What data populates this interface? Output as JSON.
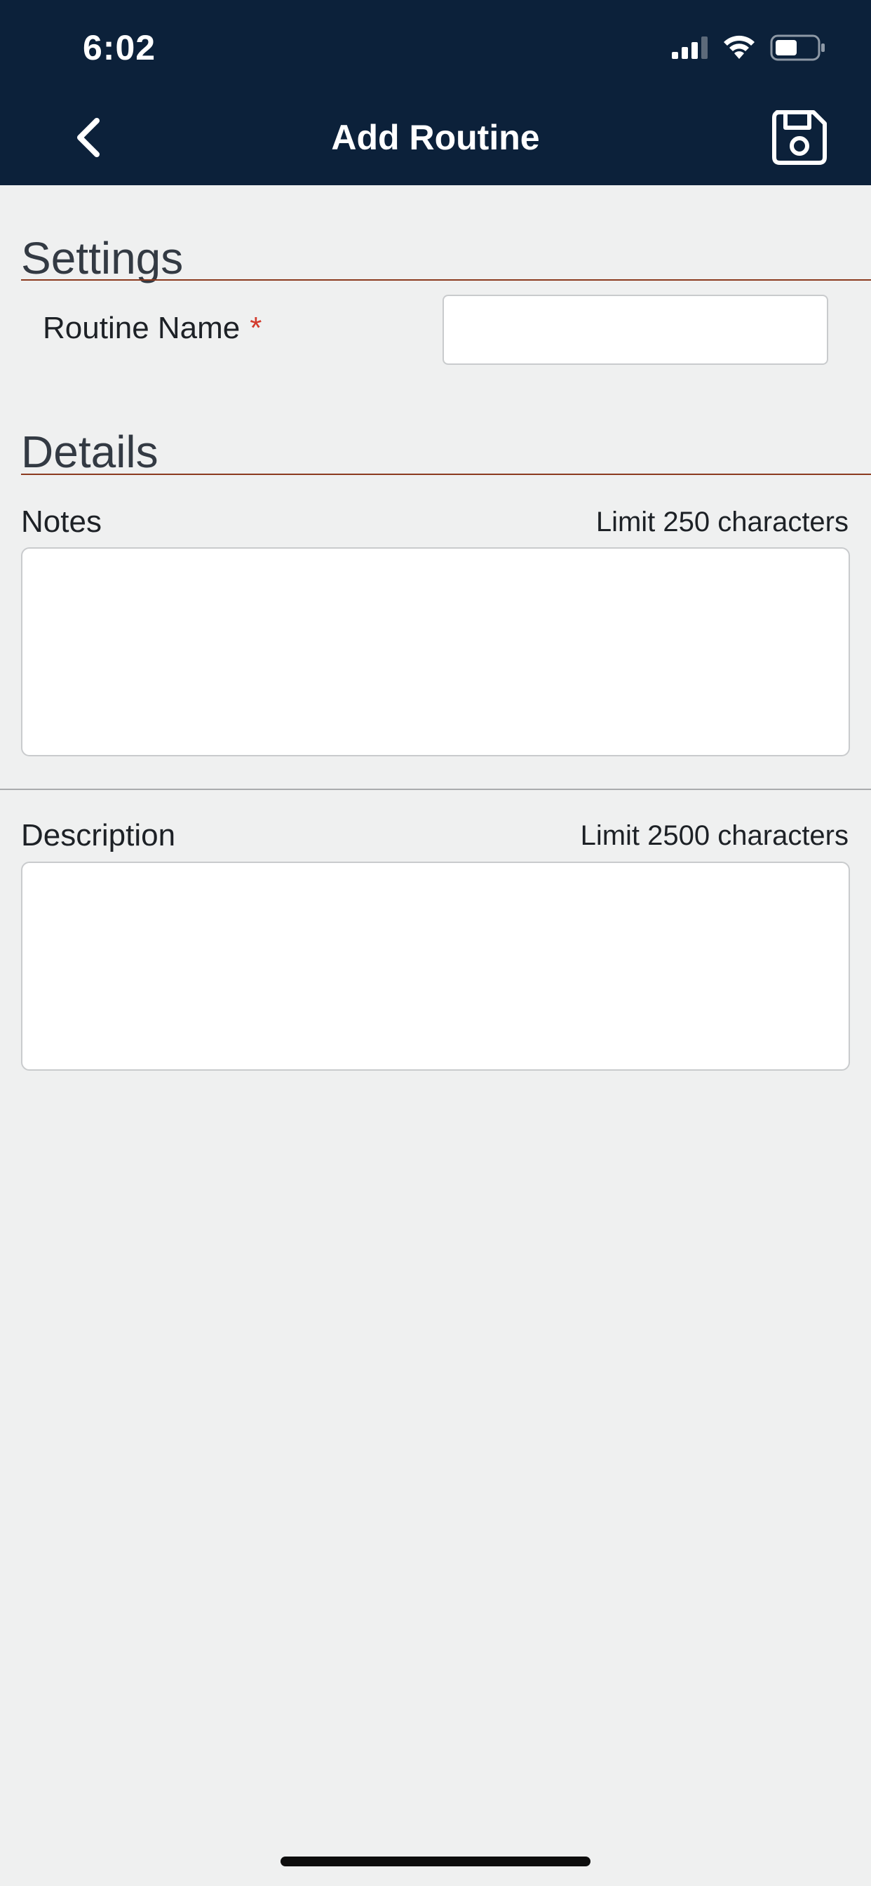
{
  "status_bar": {
    "time": "6:02",
    "icons": [
      "cellular-signal-icon",
      "wifi-icon",
      "battery-icon"
    ]
  },
  "nav": {
    "title": "Add Routine",
    "back_icon": "chevron-left-icon",
    "save_icon": "floppy-disk-icon"
  },
  "settings": {
    "heading": "Settings",
    "routine_name_label": "Routine Name",
    "required_marker": "*",
    "routine_name_value": ""
  },
  "details": {
    "heading": "Details",
    "notes_label": "Notes",
    "notes_limit": "Limit 250 characters",
    "notes_value": "",
    "description_label": "Description",
    "description_limit": "Limit 2500 characters",
    "description_value": ""
  },
  "colors": {
    "header_bg": "#0c213a",
    "page_bg": "#eff0f0",
    "accent_rule": "#8b3a1f",
    "required": "#d33a2c"
  }
}
